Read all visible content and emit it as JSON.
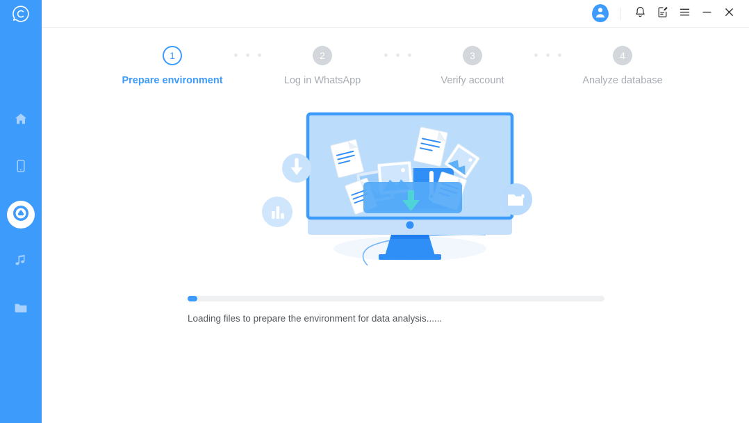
{
  "app": {
    "brand_color": "#3d9bfc",
    "logo_icon": "chat-bubble-c-logo"
  },
  "titlebar": {
    "avatar_icon": "user-avatar-icon",
    "notification_icon": "bell-icon",
    "feedback_icon": "edit-note-icon",
    "menu_icon": "hamburger-menu-icon",
    "minimize_icon": "minimize-icon",
    "close_icon": "close-icon"
  },
  "sidebar": {
    "items": [
      {
        "icon": "home-icon",
        "name": "home",
        "active": false
      },
      {
        "icon": "phone-icon",
        "name": "phone",
        "active": false
      },
      {
        "icon": "whatsapp-transfer-icon",
        "name": "whatsapp-transfer",
        "active": true
      },
      {
        "icon": "music-note-icon",
        "name": "music",
        "active": false
      },
      {
        "icon": "folder-icon",
        "name": "files",
        "active": false
      }
    ]
  },
  "stepper": {
    "steps": [
      {
        "number": "1",
        "label": "Prepare environment",
        "state": "current"
      },
      {
        "number": "2",
        "label": "Log in WhatsApp",
        "state": "pending"
      },
      {
        "number": "3",
        "label": "Verify account",
        "state": "pending"
      },
      {
        "number": "4",
        "label": "Analyze database",
        "state": "pending"
      }
    ],
    "separator_dots": 3
  },
  "illustration": {
    "name": "desktop-file-loading-illustration",
    "badges": [
      {
        "name": "download-badge-icon"
      },
      {
        "name": "bar-chart-badge-icon"
      },
      {
        "name": "video-folder-badge-icon"
      }
    ],
    "screen_icon": "folder-with-documents-download",
    "colors": {
      "monitor_border": "#3d9bfc",
      "screen_fill": "#bcdcfb",
      "chin": "#c6e0fb",
      "stand": "#2f8ff7",
      "arrow": "#4fd2d8"
    }
  },
  "progress": {
    "percent": 2,
    "status_text": "Loading files to prepare the environment for data analysis......",
    "fill_color": "#3d9bfc",
    "track_color": "#eef0f2"
  }
}
